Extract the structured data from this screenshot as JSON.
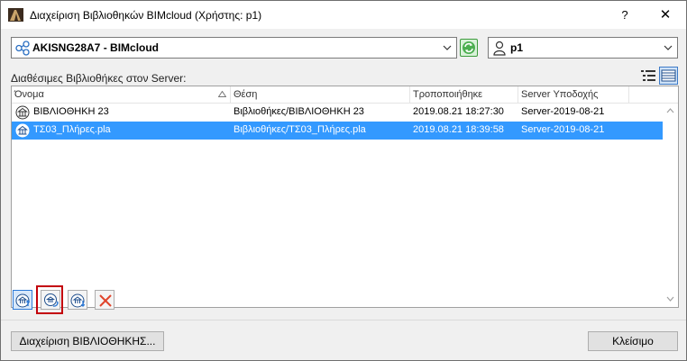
{
  "window": {
    "title": "Διαχείριση Βιβλιοθηκών BIMcloud (Χρήστης: p1)",
    "help_label": "?",
    "close_label": "✕"
  },
  "server_select": {
    "value": "AKISNG28A7 - BIMcloud",
    "icon": "server-network-icon"
  },
  "user_select": {
    "value": "p1",
    "icon": "user-icon"
  },
  "libraries": {
    "section_label": "Διαθέσιμες Βιβλιοθήκες στον Server:",
    "columns": [
      "Όνομα",
      "Θέση",
      "Τροποποιήθηκε",
      "Server Υποδοχής"
    ],
    "rows": [
      {
        "name": "ΒΙΒΛΙΟΘΗΚΗ 23",
        "location": "Βιβλιοθήκες/ΒΙΒΛΙΟΘΗΚΗ 23",
        "modified": "2019.08.21 18:27:30",
        "host": "Server-2019-08-21",
        "selected": false
      },
      {
        "name": "ΤΣ03_Πλήρες.pla",
        "location": "Βιβλιοθήκες/ΤΣ03_Πλήρες.pla",
        "modified": "2019.08.21 18:39:58",
        "host": "Server-2019-08-21",
        "selected": true
      }
    ]
  },
  "toolbar": {
    "buttons": [
      {
        "name": "upload-library-icon"
      },
      {
        "name": "sync-library-icon",
        "highlighted": true
      },
      {
        "name": "download-library-icon"
      },
      {
        "name": "delete-icon"
      }
    ],
    "highlight_color": "#c3000a"
  },
  "footer": {
    "manage_label": "Διαχείριση ΒΙΒΛΙΟΘΗΚΗΣ...",
    "close_label": "Κλείσιμο"
  },
  "colors": {
    "selection": "#3399ff",
    "accent": "#2d7ad8"
  }
}
